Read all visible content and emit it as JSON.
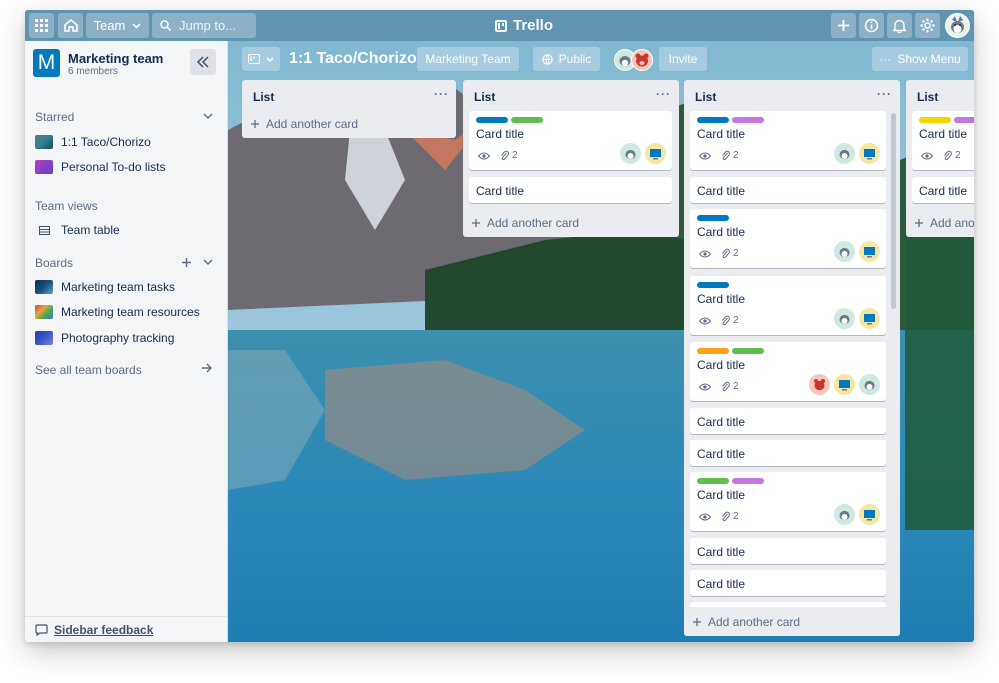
{
  "app": {
    "name": "Trello"
  },
  "topbar": {
    "apps_icon": "grid-icon",
    "home_icon": "home-icon",
    "team_label": "Team",
    "search_placeholder": "Jump to...",
    "right_icons": [
      "plus-icon",
      "info-icon",
      "bell-icon",
      "gear-icon",
      "avatar"
    ]
  },
  "sidebar": {
    "team_initial": "M",
    "team_name": "Marketing team",
    "team_members": "6 members",
    "starred_title": "Starred",
    "starred": [
      {
        "label": "1:1 Taco/Chorizo",
        "thumb": "#2f7f93"
      },
      {
        "label": "Personal To-do lists",
        "thumb": "#7b3fc5"
      }
    ],
    "views_title": "Team views",
    "views": [
      {
        "label": "Team table"
      }
    ],
    "boards_title": "Boards",
    "boards": [
      {
        "label": "Marketing team tasks",
        "thumb": "#1b4f7a"
      },
      {
        "label": "Marketing team resources",
        "thumb": "#d6443a"
      },
      {
        "label": "Photography tracking",
        "thumb": "#3c55c9"
      }
    ],
    "see_all": "See all team boards",
    "feedback": "Sidebar feedback"
  },
  "board": {
    "title": "1:1 Taco/Chorizo",
    "team_button": "Marketing Team",
    "visibility": "Public",
    "invite": "Invite",
    "show_menu": "Show Menu"
  },
  "lists": [
    {
      "title": "List",
      "add_card": "Add another card",
      "cards": []
    },
    {
      "title": "List",
      "add_card": "Add another card",
      "cards": [
        {
          "title": "Card title",
          "labels": [
            "#0079bf",
            "#61bd4f"
          ],
          "attachments": "2",
          "avatars": [
            "husky",
            "computer"
          ]
        },
        {
          "title": "Card title"
        }
      ]
    },
    {
      "title": "List",
      "add_card": "Add another card",
      "cards": [
        {
          "title": "Card title",
          "labels": [
            "#0079bf",
            "#c377e0"
          ],
          "attachments": "2",
          "avatars": [
            "husky",
            "computer"
          ]
        },
        {
          "title": "Card title"
        },
        {
          "title": "Card title",
          "labels": [
            "#0079bf"
          ],
          "attachments": "2",
          "avatars": [
            "husky",
            "computer"
          ]
        },
        {
          "title": "Card title",
          "labels": [
            "#0079bf"
          ],
          "attachments": "2",
          "avatars": [
            "husky",
            "computer"
          ]
        },
        {
          "title": "Card title",
          "labels": [
            "#ff9f1a",
            "#61bd4f"
          ],
          "attachments": "2",
          "avatars": [
            "bear",
            "computer",
            "husky"
          ]
        },
        {
          "title": "Card title"
        },
        {
          "title": "Card title"
        },
        {
          "title": "Card title",
          "labels": [
            "#61bd4f",
            "#c377e0"
          ],
          "attachments": "2",
          "avatars": [
            "husky",
            "computer"
          ]
        },
        {
          "title": "Card title"
        },
        {
          "title": "Card title"
        }
      ]
    },
    {
      "title": "List",
      "add_card": "Add another card",
      "cards": [
        {
          "title": "Card title",
          "labels": [
            "#f2d600",
            "#c377e0"
          ],
          "attachments": "2"
        },
        {
          "title": "Card title"
        }
      ]
    }
  ]
}
